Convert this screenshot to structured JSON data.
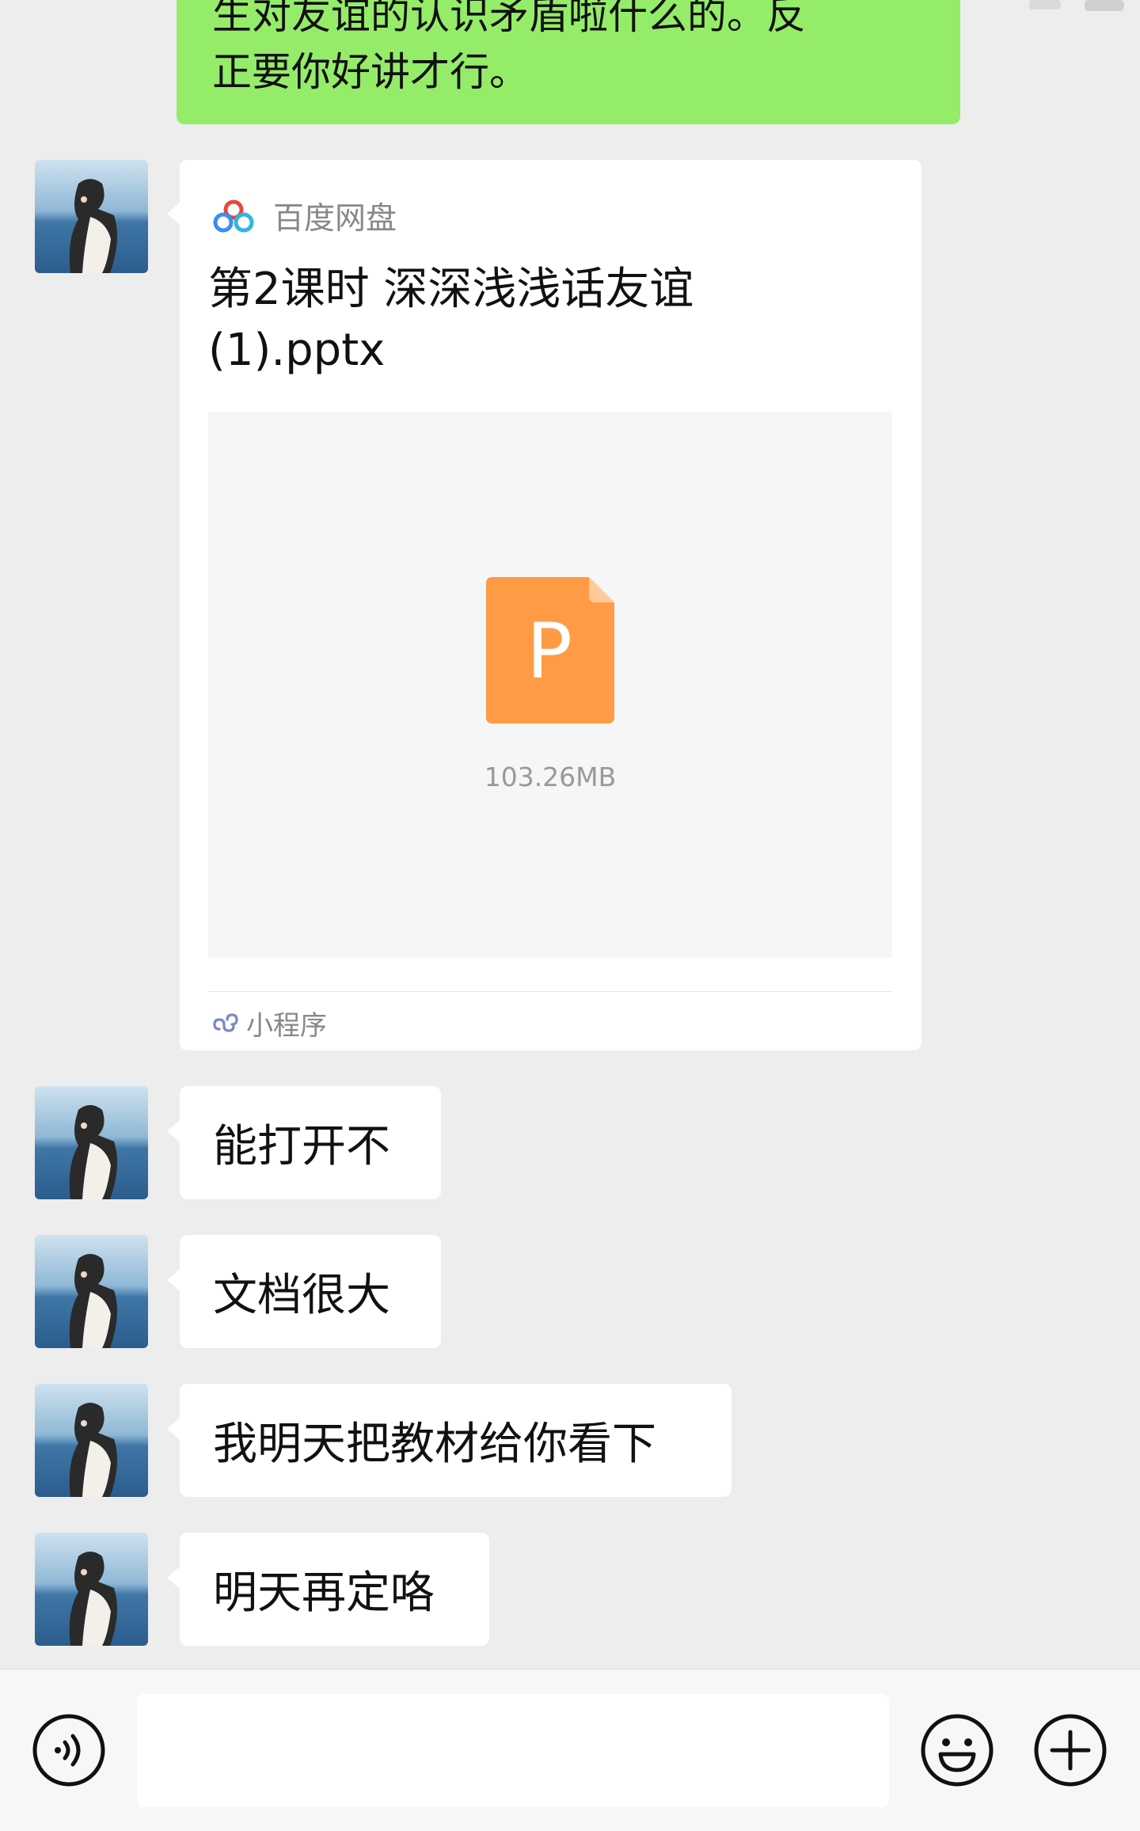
{
  "previous_message": {
    "line1": "生对友谊的认识矛盾啦什么的。反",
    "line2": "正要你好讲才行。"
  },
  "card": {
    "source_label": "百度网盘",
    "title_line1": "第2课时  深深浅浅话友谊",
    "title_line2": "(1).pptx",
    "file_icon_letter": "P",
    "file_size": "103.26MB",
    "mini_program_label": "小程序",
    "accent_color": "#ff9b44"
  },
  "messages": [
    {
      "text": "能打开不"
    },
    {
      "text": "文档很大"
    },
    {
      "text": "我明天把教材给你看下"
    },
    {
      "text": "明天再定咯"
    }
  ],
  "input_bar": {
    "voice_icon": "voice-icon",
    "emoji_icon": "emoji-icon",
    "plus_icon": "plus-icon"
  },
  "colors": {
    "background": "#ededed",
    "sent_bubble": "#95ec69",
    "received_bubble": "#ffffff"
  }
}
